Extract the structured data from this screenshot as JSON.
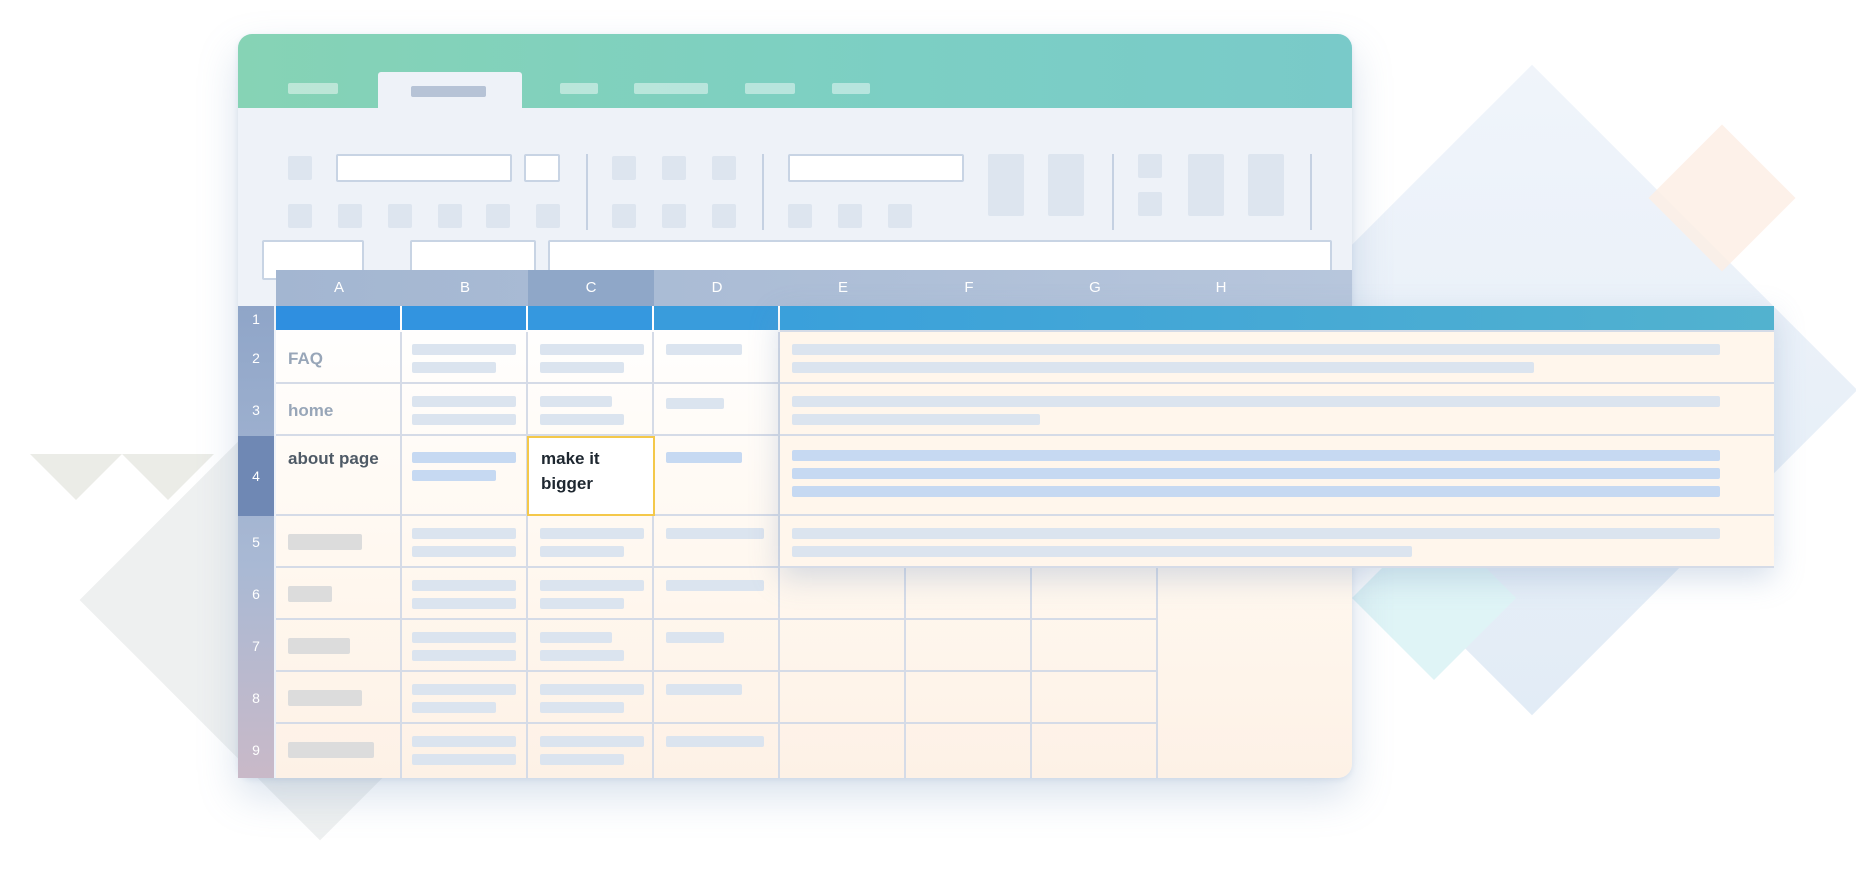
{
  "columns": [
    "A",
    "B",
    "C",
    "D",
    "E",
    "F",
    "G",
    "H"
  ],
  "rows": [
    "1",
    "2",
    "3",
    "4",
    "5",
    "6",
    "7",
    "8",
    "9"
  ],
  "cells": {
    "a2": "FAQ",
    "a3": "home",
    "a4": "about page",
    "c4": "make it bigger"
  },
  "colors": {
    "titlebar": "#7ccfc4",
    "header_row": "#2f8fe0",
    "selected_border": "#f4c84a",
    "sheet_background": "#fff6ec"
  },
  "icons": [
    "ribbon-placeholder-icons"
  ]
}
